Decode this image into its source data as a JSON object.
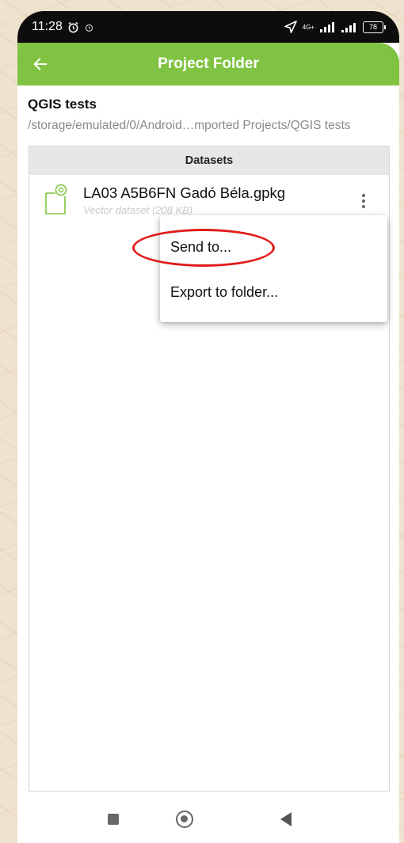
{
  "status_bar": {
    "time": "11:28",
    "network_label": "4G+",
    "battery": "78"
  },
  "app_bar": {
    "title": "Project Folder"
  },
  "folder": {
    "name": "QGIS tests",
    "path": "/storage/emulated/0/Android…mported Projects/QGIS tests"
  },
  "datasets": {
    "header": "Datasets",
    "items": [
      {
        "name": "LA03 A5B6FN Gadó Béla.gpkg",
        "subtitle": "Vector dataset (208 KB)"
      }
    ]
  },
  "context_menu": {
    "items": [
      {
        "label": "Send to..."
      },
      {
        "label": "Export to folder..."
      }
    ]
  },
  "colors": {
    "app_bar": "#80c342",
    "highlight": "#e21b1b",
    "dataset_icon": "#80c342"
  },
  "icons": {
    "back": "arrow-left-icon",
    "dataset": "vector-dataset-icon",
    "more": "more-vertical-icon"
  }
}
